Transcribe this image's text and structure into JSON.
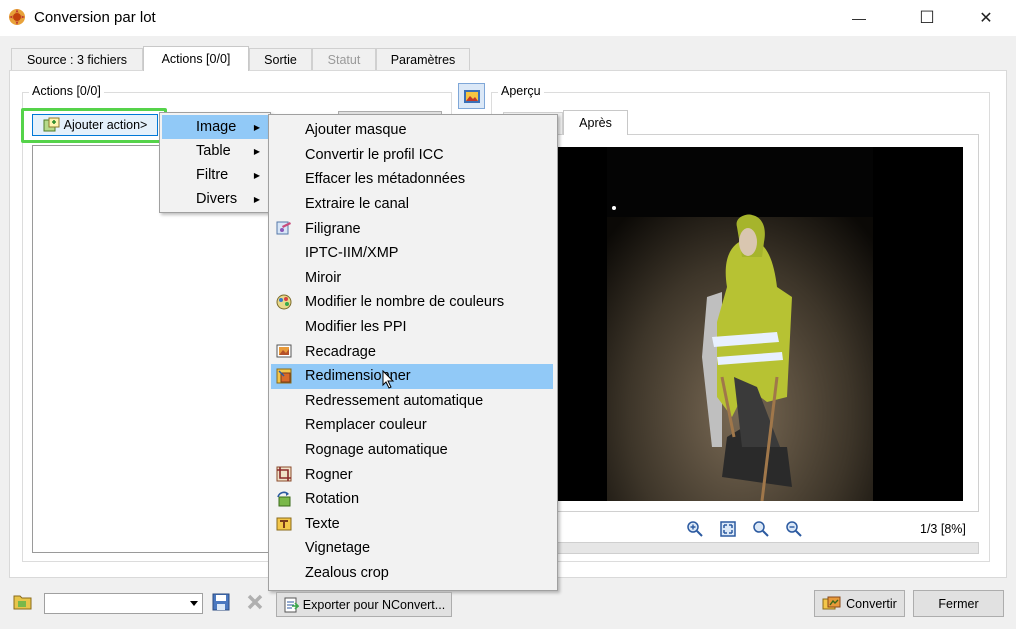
{
  "window": {
    "title": "Conversion par lot",
    "minimize_glyph": "—",
    "maximize_glyph": "☐",
    "close_glyph": "✕"
  },
  "tabs": [
    {
      "label": "Source : 3 fichiers",
      "state": "normal"
    },
    {
      "label": "Actions [0/0]",
      "state": "active"
    },
    {
      "label": "Sortie",
      "state": "normal"
    },
    {
      "label": "Statut",
      "state": "disabled"
    },
    {
      "label": "Paramètres",
      "state": "normal"
    }
  ],
  "actions_group": {
    "label": "Actions [0/0]",
    "add_action_label": "Ajouter action>"
  },
  "preview_group": {
    "label": "Aperçu",
    "tab_after_label": "Après",
    "counter": "1/3 [8%]"
  },
  "menu": {
    "items": [
      {
        "label": "Image",
        "highlighted": true
      },
      {
        "label": "Table",
        "highlighted": false
      },
      {
        "label": "Filtre",
        "highlighted": false
      },
      {
        "label": "Divers",
        "highlighted": false
      }
    ],
    "submenu_arrow": "▶"
  },
  "submenu": {
    "items": [
      {
        "label": "Ajouter masque",
        "icon": ""
      },
      {
        "label": "Convertir le profil ICC",
        "icon": ""
      },
      {
        "label": "Effacer les métadonnées",
        "icon": ""
      },
      {
        "label": "Extraire le canal",
        "icon": ""
      },
      {
        "label": "Filigrane",
        "icon": "watermark-icon"
      },
      {
        "label": "IPTC-IIM/XMP",
        "icon": ""
      },
      {
        "label": "Miroir",
        "icon": ""
      },
      {
        "label": "Modifier le nombre de couleurs",
        "icon": "palette-icon"
      },
      {
        "label": "Modifier les PPI",
        "icon": ""
      },
      {
        "label": "Recadrage",
        "icon": "canvas-icon"
      },
      {
        "label": "Redimensionner",
        "icon": "resize-icon",
        "highlighted": true
      },
      {
        "label": "Redressement automatique",
        "icon": ""
      },
      {
        "label": "Remplacer couleur",
        "icon": ""
      },
      {
        "label": "Rognage automatique",
        "icon": ""
      },
      {
        "label": "Rogner",
        "icon": "crop-icon"
      },
      {
        "label": "Rotation",
        "icon": "rotate-icon"
      },
      {
        "label": "Texte",
        "icon": "text-icon"
      },
      {
        "label": "Vignetage",
        "icon": ""
      },
      {
        "label": "Zealous crop",
        "icon": ""
      }
    ]
  },
  "bottom": {
    "export_label": "Exporter pour NConvert...",
    "convert_label": "Convertir",
    "close_label": "Fermer",
    "preset_value": ""
  },
  "colors": {
    "highlight": "#91c9f7",
    "focus_ring": "#55d34a",
    "preview_bg": "#000000"
  }
}
